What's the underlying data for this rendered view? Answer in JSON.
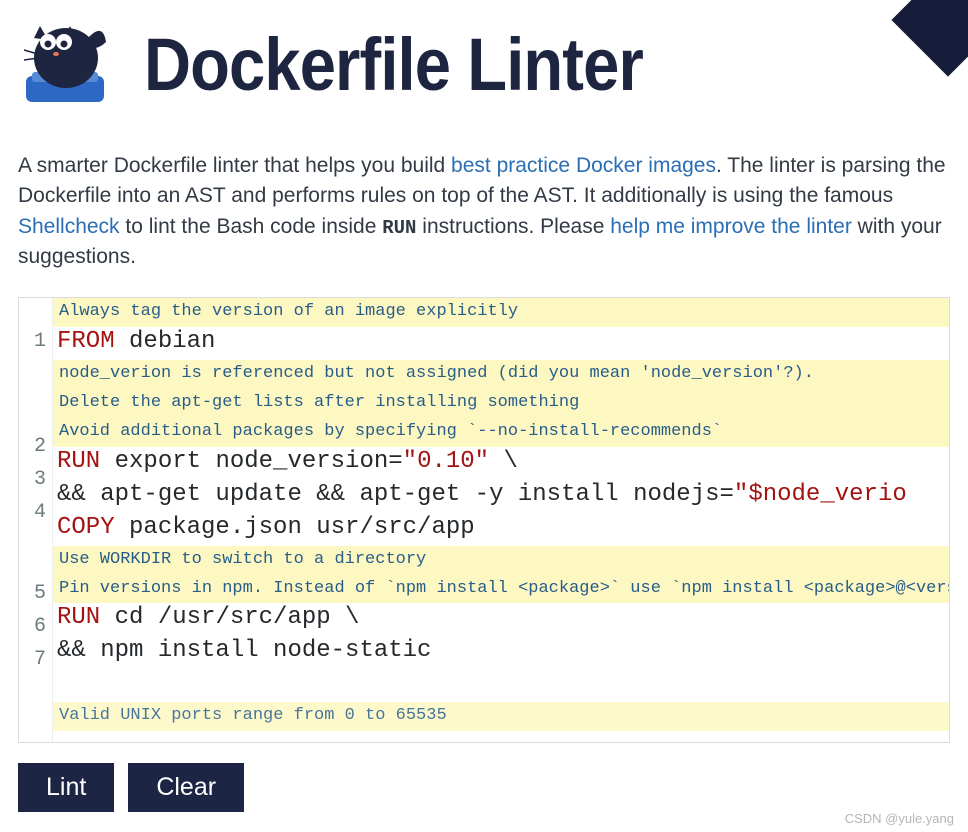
{
  "header": {
    "title": "Dockerfile Linter"
  },
  "intro": {
    "t1": "A smarter Dockerfile linter that helps you build ",
    "link1": "best practice Docker images",
    "t2": ". The linter is parsing the Dockerfile into an AST and performs rules on top of the AST. It additionally is using the famous ",
    "link2": "Shellcheck",
    "t3": " to lint the Bash code inside ",
    "runcode": "RUN",
    "t4": " instructions. Please ",
    "link3": "help me improve the linter",
    "t5": " with your suggestions."
  },
  "editor": {
    "warnings": {
      "w1": "Always tag the version of an image explicitly",
      "w2a": "node_verion is referenced but not assigned (did you mean 'node_version'?).",
      "w2b": "Delete the apt-get lists after installing something",
      "w2c": "Avoid additional packages by specifying `--no-install-recommends`",
      "w3a": "Use WORKDIR to switch to a directory",
      "w3b": "Pin versions in npm. Instead of `npm install <package>` use `npm install <package>@<version>`",
      "w4": "Valid UNIX ports range from 0 to 65535"
    },
    "lines": {
      "l1": {
        "n": "1",
        "kw": "FROM",
        "rest": " debian"
      },
      "l2": {
        "n": "2",
        "kw": "RUN",
        "rest1": " export node_version=",
        "str": "\"0.10\"",
        "rest2": " \\"
      },
      "l3": {
        "n": "3",
        "rest1": "&& apt-get update && apt-get -y install nodejs=",
        "str": "\"$node_verio"
      },
      "l4": {
        "n": "4",
        "kw": "COPY",
        "rest": " package.json usr/src/app"
      },
      "l5": {
        "n": "5",
        "kw": "RUN",
        "rest": " cd /usr/src/app \\"
      },
      "l6": {
        "n": "6",
        "rest": "&& npm install node-static"
      },
      "l7": {
        "n": "7"
      }
    }
  },
  "buttons": {
    "lint": "Lint",
    "clear": "Clear"
  },
  "watermark": "CSDN @yule.yang"
}
